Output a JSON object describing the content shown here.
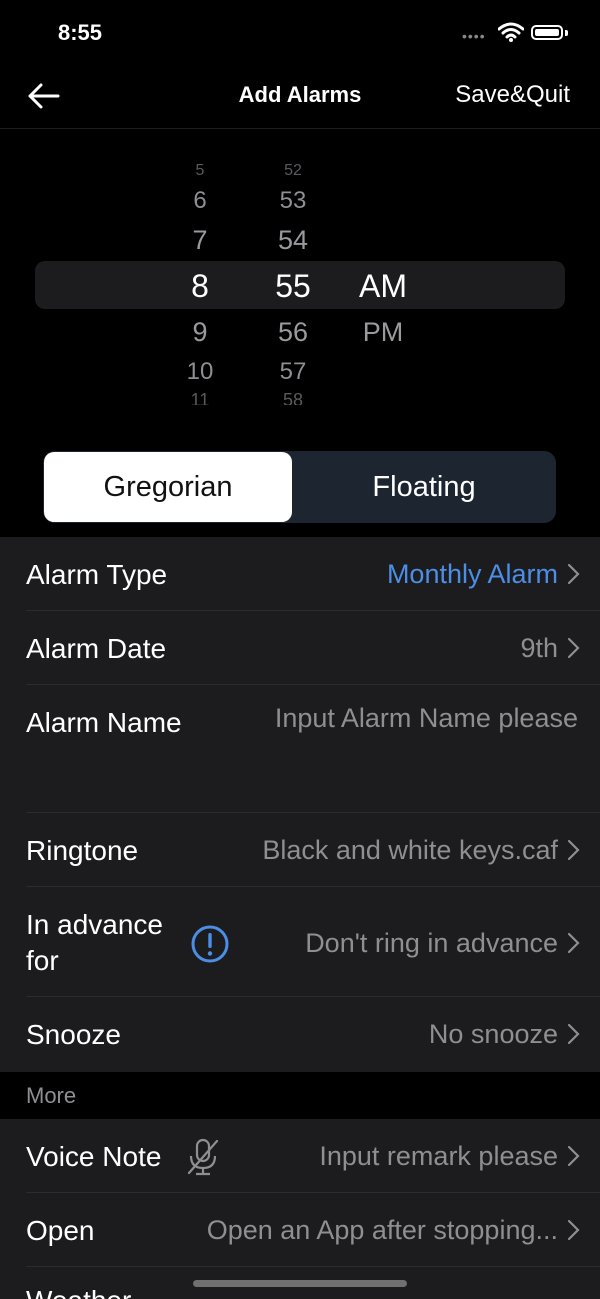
{
  "status": {
    "time": "8:55"
  },
  "nav": {
    "title": "Add Alarms",
    "save_label": "Save&Quit"
  },
  "picker": {
    "hours": [
      "5",
      "6",
      "7",
      "8",
      "9",
      "10",
      "11"
    ],
    "minutes": [
      "52",
      "53",
      "54",
      "55",
      "56",
      "57",
      "58"
    ],
    "ampm": [
      "AM",
      "PM"
    ],
    "selected": {
      "hour": "8",
      "minute": "55",
      "ampm": "AM"
    }
  },
  "calendar_toggle": {
    "left": "Gregorian",
    "right": "Floating",
    "selected": "Gregorian"
  },
  "settings": {
    "alarm_type": {
      "label": "Alarm Type",
      "value": "Monthly Alarm"
    },
    "alarm_date": {
      "label": "Alarm Date",
      "value": "9th"
    },
    "alarm_name": {
      "label": "Alarm Name",
      "placeholder": "Input Alarm Name please"
    },
    "ringtone": {
      "label": "Ringtone",
      "value": "Black and white keys.caf"
    },
    "in_advance": {
      "label_line1": "In advance",
      "label_line2": "for",
      "value": "Don't ring in advance"
    },
    "snooze": {
      "label": "Snooze",
      "value": "No snooze"
    }
  },
  "more": {
    "header": "More",
    "voice_note": {
      "label": "Voice Note",
      "value": "Input remark please"
    },
    "open": {
      "label": "Open",
      "value": "Open an App after stopping..."
    },
    "next_label": "Weather"
  },
  "colors": {
    "accent": "#4c8ee6",
    "background": "#000000",
    "cell": "#1c1c1e",
    "secondary": "#8e8e93"
  }
}
